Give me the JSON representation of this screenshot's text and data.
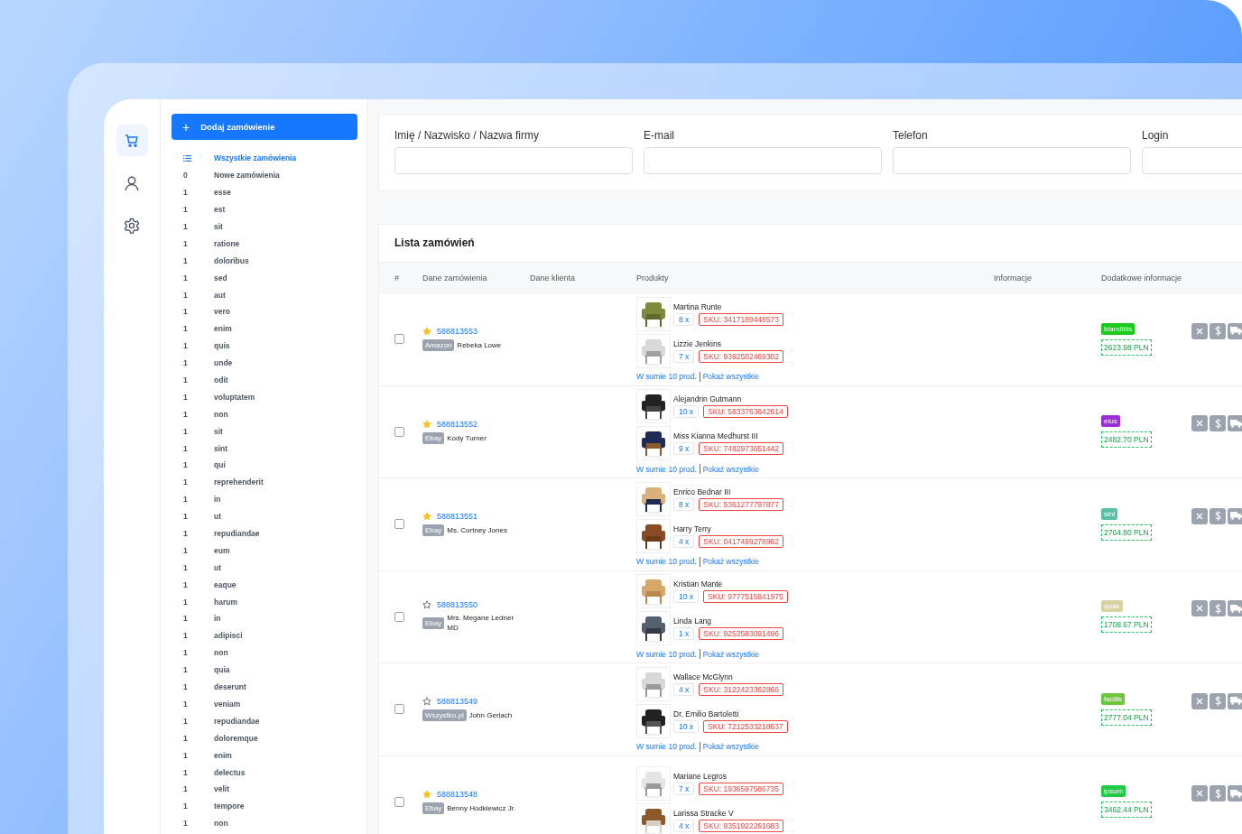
{
  "rail": [
    {
      "kind": "cart",
      "selected": true
    },
    {
      "kind": "user",
      "selected": false
    },
    {
      "kind": "settings",
      "selected": false
    }
  ],
  "sidebar": {
    "add_button": {
      "icon": "+",
      "label": "Dodaj zamówienie"
    },
    "items": [
      {
        "label": "Wszystkie zamówienia",
        "selected": true
      },
      {
        "count": "0",
        "label": "Nowe zamówienia",
        "selected": false
      },
      {
        "count": "1",
        "label": "esse",
        "selected": false
      },
      {
        "count": "1",
        "label": "est",
        "selected": false
      },
      {
        "count": "1",
        "label": "sit",
        "selected": false
      },
      {
        "count": "1",
        "label": "ratione",
        "selected": false
      },
      {
        "count": "1",
        "label": "doloribus",
        "selected": false
      },
      {
        "count": "1",
        "label": "sed",
        "selected": false
      },
      {
        "count": "1",
        "label": "aut",
        "selected": false
      },
      {
        "count": "1",
        "label": "vero",
        "selected": false
      },
      {
        "count": "1",
        "label": "enim",
        "selected": false
      },
      {
        "count": "1",
        "label": "quis",
        "selected": false
      },
      {
        "count": "1",
        "label": "unde",
        "selected": false
      },
      {
        "count": "1",
        "label": "odit",
        "selected": false
      },
      {
        "count": "1",
        "label": "voluptatem",
        "selected": false
      },
      {
        "count": "1",
        "label": "non",
        "selected": false
      },
      {
        "count": "1",
        "label": "sit",
        "selected": false
      },
      {
        "count": "1",
        "label": "sint",
        "selected": false
      },
      {
        "count": "1",
        "label": "qui",
        "selected": false
      },
      {
        "count": "1",
        "label": "reprehenderit",
        "selected": false
      },
      {
        "count": "1",
        "label": "in",
        "selected": false
      },
      {
        "count": "1",
        "label": "ut",
        "selected": false
      },
      {
        "count": "1",
        "label": "repudiandae",
        "selected": false
      },
      {
        "count": "1",
        "label": "eum",
        "selected": false
      },
      {
        "count": "1",
        "label": "ut",
        "selected": false
      },
      {
        "count": "1",
        "label": "eaque",
        "selected": false
      },
      {
        "count": "1",
        "label": "harum",
        "selected": false
      },
      {
        "count": "1",
        "label": "in",
        "selected": false
      },
      {
        "count": "1",
        "label": "adipisci",
        "selected": false
      },
      {
        "count": "1",
        "label": "non",
        "selected": false
      },
      {
        "count": "1",
        "label": "quia",
        "selected": false
      },
      {
        "count": "1",
        "label": "deserunt",
        "selected": false
      },
      {
        "count": "1",
        "label": "veniam",
        "selected": false
      },
      {
        "count": "1",
        "label": "repudiandae",
        "selected": false
      },
      {
        "count": "1",
        "label": "doloremque",
        "selected": false
      },
      {
        "count": "1",
        "label": "enim",
        "selected": false
      },
      {
        "count": "1",
        "label": "delectus",
        "selected": false
      },
      {
        "count": "1",
        "label": "velit",
        "selected": false
      },
      {
        "count": "1",
        "label": "tempore",
        "selected": false
      },
      {
        "count": "1",
        "label": "non",
        "selected": false
      }
    ]
  },
  "filters": [
    {
      "label": "Imię / Nazwisko / Nazwa firmy"
    },
    {
      "label": "E-mail"
    },
    {
      "label": "Telefon"
    },
    {
      "label": "Login"
    }
  ],
  "orders": {
    "title": "Lista zamówień",
    "columns": [
      "#",
      "Dane zamówienia",
      "Dane klienta",
      "Produkty",
      "Informacje",
      "Dodatkowe informacje"
    ],
    "rows": [
      {
        "checked": false,
        "starred": true,
        "number": "588813553",
        "source": "Amazon",
        "client": "Rebeka Lowe",
        "products": [
          {
            "name": "Martina Runte",
            "qty": "8 x",
            "sku": "SKU: 3417189448573"
          },
          {
            "name": "Lizzie Jenkins",
            "qty": "7 x",
            "sku": "SKU: 9392502469302"
          }
        ],
        "summary": "W sumie 10 prod.",
        "show_all": "Pokaż wszystkie",
        "tag": "blanditiis",
        "color": "#1ec91e",
        "price": "2623.98 PLN"
      },
      {
        "checked": false,
        "starred": true,
        "number": "588813552",
        "source": "Ebay",
        "client": "Kody Turner",
        "products": [
          {
            "name": "Alejandrin Gutmann",
            "qty": "10 x",
            "sku": "SKU: 5833763642614"
          },
          {
            "name": "Miss Kianna Medhurst III",
            "qty": "9 x",
            "sku": "SKU: 7482973651442"
          }
        ],
        "summary": "W sumie 10 prod.",
        "show_all": "Pokaż wszystkie",
        "tag": "eius",
        "color": "#9b2fd6",
        "price": "2482.70 PLN"
      },
      {
        "checked": false,
        "starred": true,
        "number": "588813551",
        "source": "Ebay",
        "client": "Ms. Cortney Jones",
        "products": [
          {
            "name": "Enrico Bednar III",
            "qty": "8 x",
            "sku": "SKU: 5361277797877"
          },
          {
            "name": "Harry Terry",
            "qty": "4 x",
            "sku": "SKU: 0417499278962"
          }
        ],
        "summary": "W sumie 10 prod.",
        "show_all": "Pokaż wszystkie",
        "tag": "sint",
        "color": "#5bbfa5",
        "price": "2764.80 PLN"
      },
      {
        "checked": false,
        "starred": false,
        "number": "588813550",
        "source": "Ebay",
        "client": "Mrs. Megane Ledner MD",
        "products": [
          {
            "name": "Kristian Mante",
            "qty": "10 x",
            "sku": "SKU: 9777515941975"
          },
          {
            "name": "Linda Lang",
            "qty": "1 x",
            "sku": "SKU: 9253583091496"
          }
        ],
        "summary": "W sumie 10 prod.",
        "show_all": "Pokaż wszystkie",
        "tag": "quae",
        "color": "#d6d3a0",
        "price": "1708.67 PLN"
      },
      {
        "checked": false,
        "starred": false,
        "number": "588813549",
        "source": "Wszystko.pl",
        "client": "John Gerlach",
        "products": [
          {
            "name": "Wallace McGlynn",
            "qty": "4 x",
            "sku": "SKU: 3122423362866"
          },
          {
            "name": "Dr. Emilio Bartoletti",
            "qty": "10 x",
            "sku": "SKU: 7212533218637"
          }
        ],
        "summary": "W sumie 10 prod.",
        "show_all": "Pokaż wszystkie",
        "tag": "facilis",
        "color": "#6cc83a",
        "price": "2777.04 PLN"
      },
      {
        "checked": false,
        "starred": true,
        "number": "588813548",
        "source": "Ebay",
        "client": "Benny Hodkiewicz Jr.",
        "products": [
          {
            "name": "Mariane Legros",
            "qty": "7 x",
            "sku": "SKU: 1936597586735"
          },
          {
            "name": "Larissa Stracke V",
            "qty": "4 x",
            "sku": "SKU: 8351922261683"
          }
        ],
        "tag": "ipsum",
        "color": "#22c944",
        "price": "3462.44 PLN"
      }
    ]
  }
}
